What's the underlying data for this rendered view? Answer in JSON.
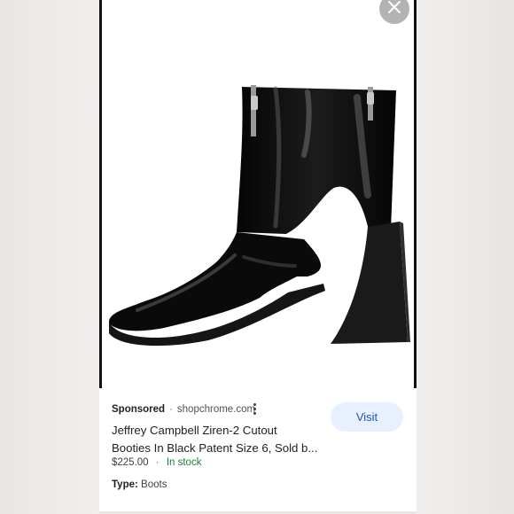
{
  "ad": {
    "sponsored_label": "Sponsored",
    "separator": "·",
    "domain": "shopchrome.com",
    "title_line1": "Jeffrey Campbell Ziren-2 Cutout",
    "title_line2": "Booties In Black Patent Size 6, Sold b...",
    "price": "$225.00",
    "price_separator": "·",
    "stock_status": "In stock",
    "type_label": "Type:",
    "type_value": "Boots",
    "visit_label": "Visit"
  },
  "icons": {
    "close": "close-icon",
    "more": "more-vert-icon"
  },
  "colors": {
    "visit_bg": "#e8f0fe",
    "visit_text": "#1a56b8",
    "in_stock": "#188038",
    "close_bg": "#b3b3b3"
  }
}
